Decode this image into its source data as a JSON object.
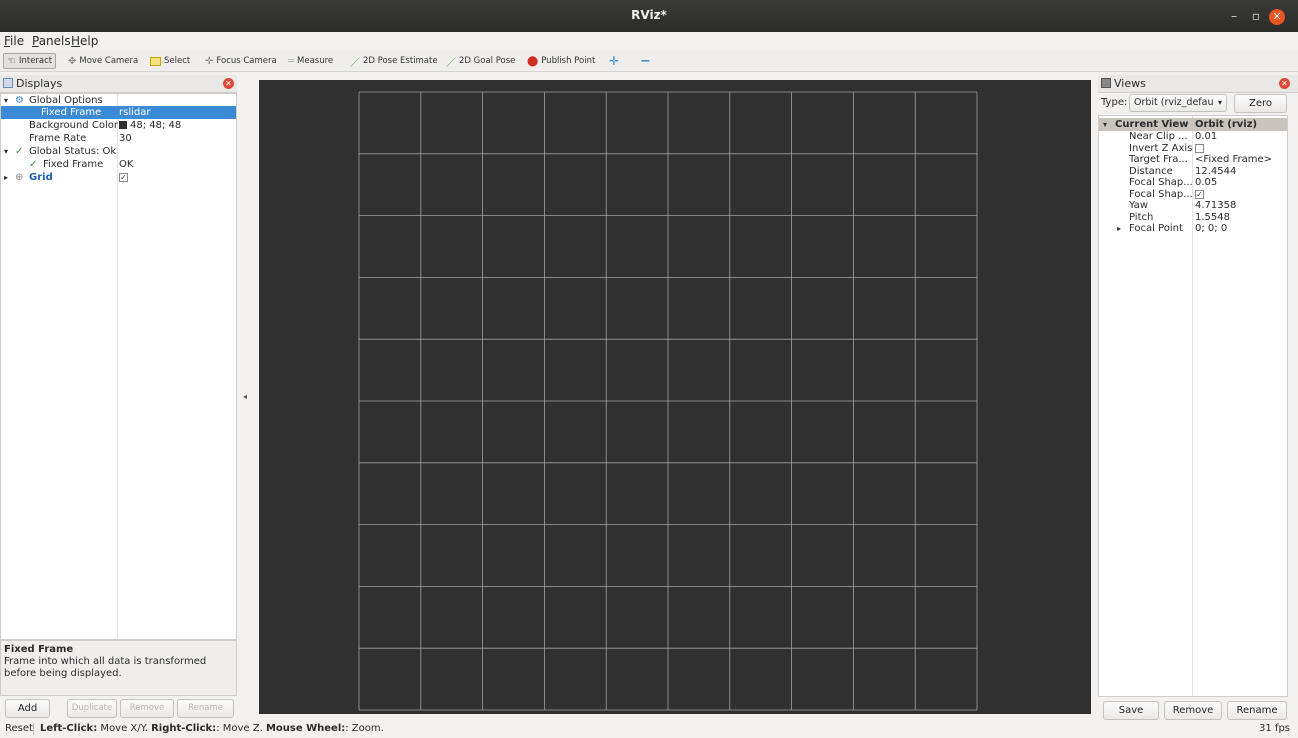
{
  "window": {
    "title": "RViz*",
    "minimize": "–",
    "maximize": "▫",
    "close": "✕"
  },
  "menu": [
    "File",
    "Panels",
    "Help"
  ],
  "toolbar": {
    "interact": "Interact",
    "move_camera": "Move Camera",
    "select": "Select",
    "focus_camera": "Focus Camera",
    "measure": "Measure",
    "pose_estimate": "2D Pose Estimate",
    "goal_pose": "2D Goal Pose",
    "publish_point": "Publish Point",
    "add_tool": "✛",
    "remove_tool": "−"
  },
  "displays": {
    "title": "Displays",
    "global_options": "Global Options",
    "fixed_frame_label": "Fixed Frame",
    "fixed_frame_value": "rslidar",
    "background_color_label": "Background Color",
    "background_color_value": "48; 48; 48",
    "background_color": "#303030",
    "frame_rate_label": "Frame Rate",
    "frame_rate_value": "30",
    "global_status": "Global Status: Ok",
    "status_fixed_frame_label": "Fixed Frame",
    "status_fixed_frame_value": "OK",
    "grid_label": "Grid",
    "grid_check": "✓",
    "desc_title": "Fixed Frame",
    "desc_text": "Frame into which all data is transformed before being displayed.",
    "buttons": {
      "add": "Add",
      "duplicate": "Duplicate",
      "remove": "Remove",
      "rename": "Rename"
    }
  },
  "views": {
    "title": "Views",
    "type_label": "Type:",
    "type_value": "Orbit (rviz_defau",
    "zero": "Zero",
    "current_view_label": "Current View",
    "current_view_value": "Orbit (rviz)",
    "props": [
      {
        "k": "Near Clip ...",
        "v": "0.01"
      },
      {
        "k": "Invert Z Axis",
        "v": ""
      },
      {
        "k": "Target Fra...",
        "v": "<Fixed Frame>"
      },
      {
        "k": "Distance",
        "v": "12.4544"
      },
      {
        "k": "Focal Shap...",
        "v": "0.05"
      },
      {
        "k": "Focal Shap...",
        "v": "✓"
      },
      {
        "k": "Yaw",
        "v": "4.71358"
      },
      {
        "k": "Pitch",
        "v": "1.5548"
      },
      {
        "k": "Focal Point",
        "v": "0; 0; 0"
      }
    ],
    "buttons": {
      "save": "Save",
      "remove": "Remove",
      "rename": "Rename"
    }
  },
  "status": {
    "reset": "Reset",
    "left_click": "Left-Click:",
    "left_click_text": "Move X/Y.",
    "right_click": "Right-Click:",
    "right_click_text": ": Move Z.",
    "mouse_wheel": "Mouse Wheel:",
    "mouse_wheel_text": ": Zoom.",
    "fps": "31 fps"
  },
  "grid": {
    "cells": 10,
    "line_color": "#a0a0a0",
    "background": "#303030"
  }
}
